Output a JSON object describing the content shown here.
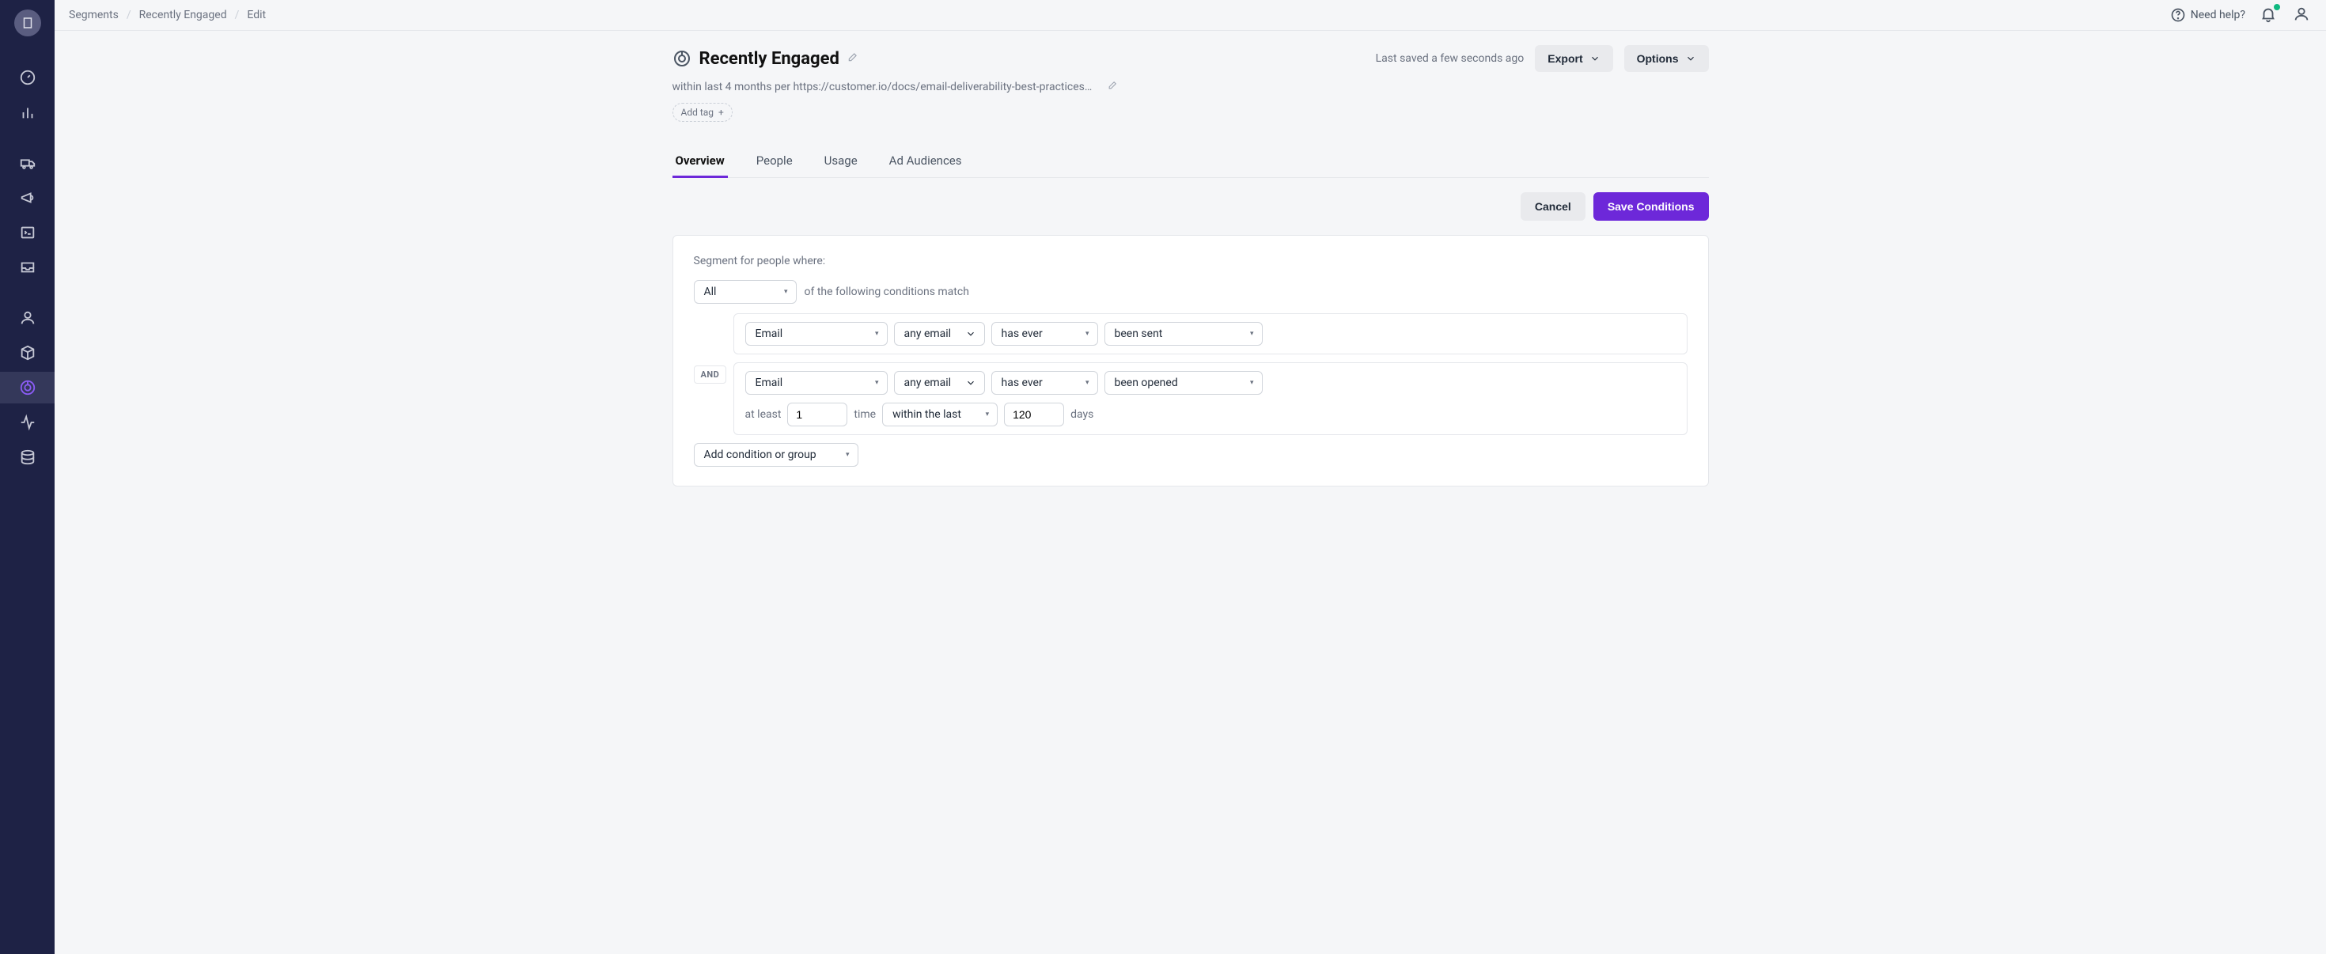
{
  "breadcrumb": {
    "segments_label": "Segments",
    "parent_label": "Recently Engaged",
    "current_label": "Edit"
  },
  "topbar": {
    "need_help_label": "Need help?"
  },
  "header": {
    "title": "Recently Engaged",
    "description": "within last 4 months per https://customer.io/docs/email-deliverability-best-practices…",
    "add_tag_label": "Add tag",
    "last_saved_label": "Last saved a few seconds ago",
    "export_label": "Export",
    "options_label": "Options"
  },
  "tabs": {
    "overview": "Overview",
    "people": "People",
    "usage": "Usage",
    "ad_audiences": "Ad Audiences"
  },
  "actions": {
    "cancel_label": "Cancel",
    "save_label": "Save Conditions"
  },
  "conditions": {
    "intro_label": "Segment for people where:",
    "match_select": "All",
    "match_suffix": "of the following conditions match",
    "and_label": "AND",
    "rows": [
      {
        "channel": "Email",
        "any": "any email",
        "when": "has ever",
        "action": "been sent"
      },
      {
        "channel": "Email",
        "any": "any email",
        "when": "has ever",
        "action": "been opened",
        "at_least_prefix": "at least",
        "at_least_value": "1",
        "time_label": "time",
        "within_select": "within the last",
        "days_value": "120",
        "days_label": "days"
      }
    ],
    "add_condition_label": "Add condition or group"
  },
  "sidebar": {
    "items": [
      {
        "name": "building-icon"
      },
      {
        "name": "dashboard-icon"
      },
      {
        "name": "analytics-icon"
      },
      {
        "name": "delivery-icon"
      },
      {
        "name": "broadcast-icon"
      },
      {
        "name": "terminal-icon"
      },
      {
        "name": "inbox-icon"
      },
      {
        "name": "person-icon"
      },
      {
        "name": "package-icon"
      },
      {
        "name": "segment-icon"
      },
      {
        "name": "activity-icon"
      },
      {
        "name": "database-icon"
      }
    ]
  }
}
